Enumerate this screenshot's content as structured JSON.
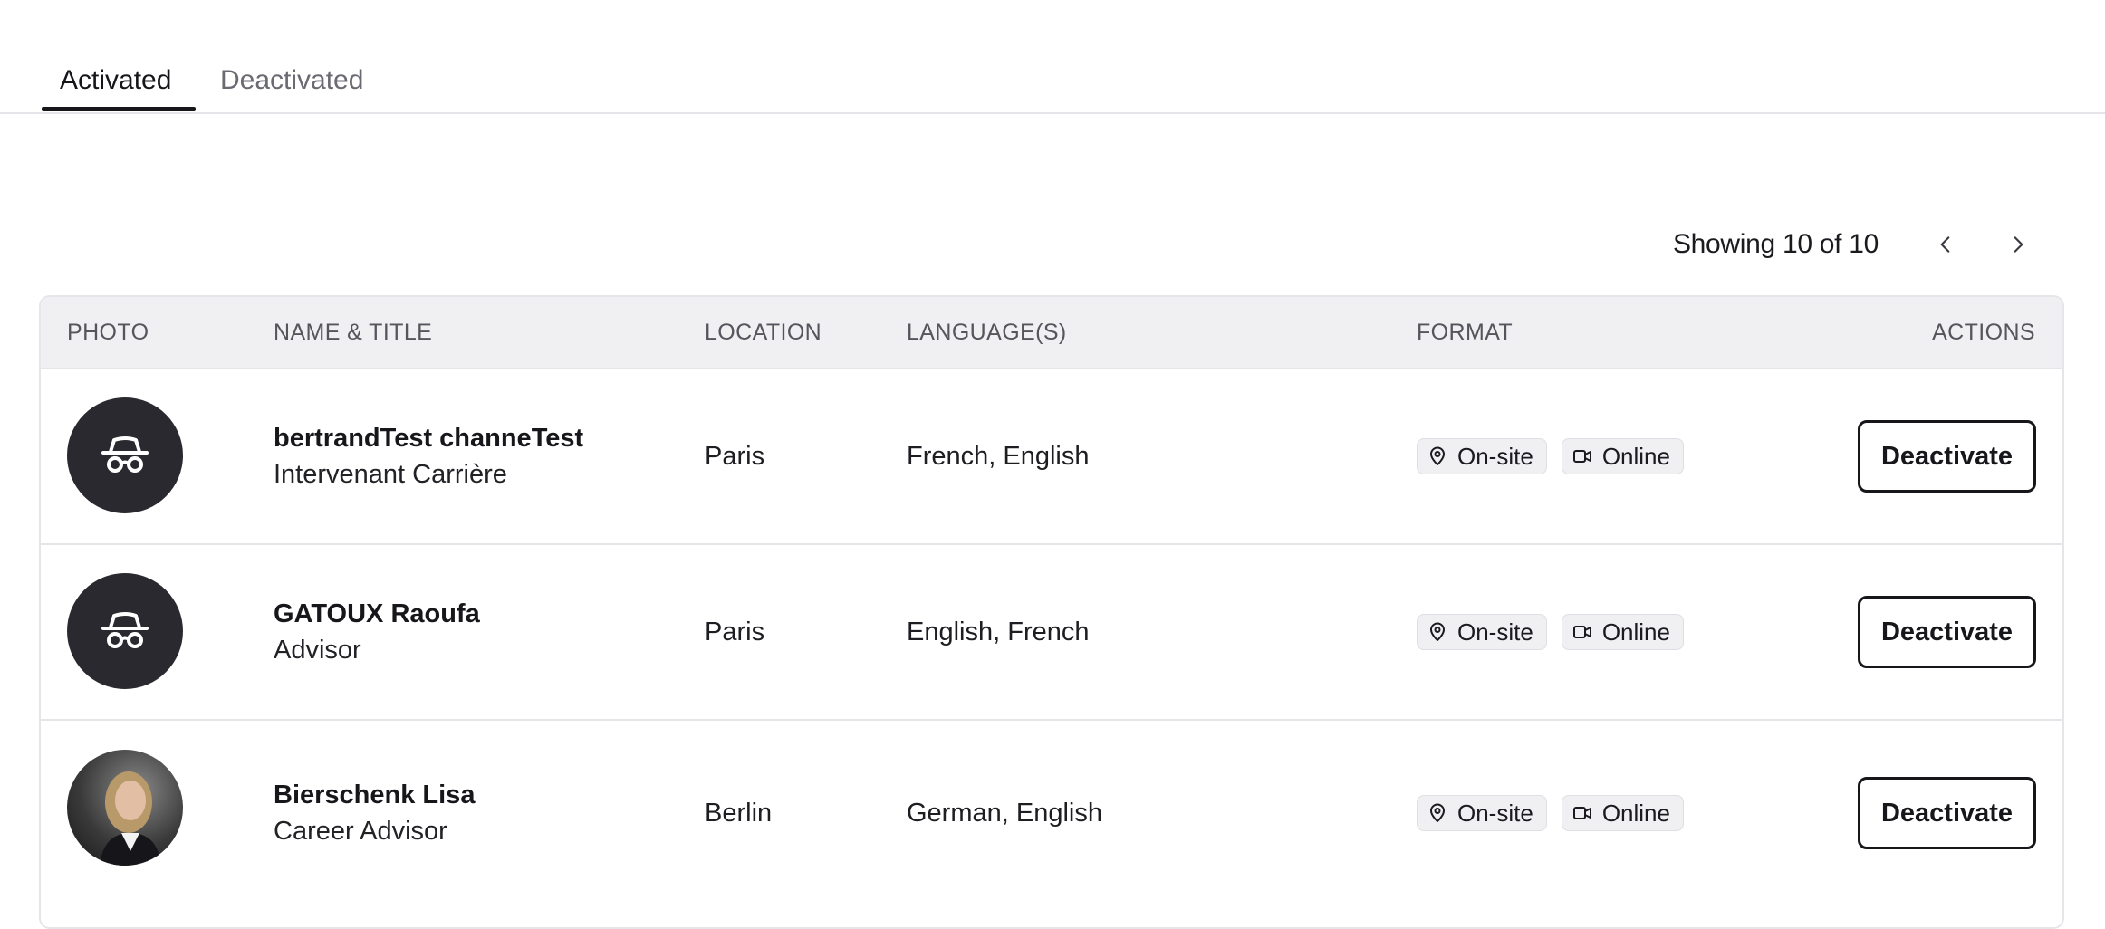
{
  "tabs": [
    {
      "label": "Activated",
      "active": true
    },
    {
      "label": "Deactivated",
      "active": false
    }
  ],
  "pagination": {
    "text": "Showing 10 of 10",
    "prev_icon": "chevron-left-icon",
    "next_icon": "chevron-right-icon"
  },
  "table": {
    "headers": {
      "photo": "PHOTO",
      "name": "NAME & TITLE",
      "location": "LOCATION",
      "language": "LANGUAGE(S)",
      "format": "FORMAT",
      "actions": "ACTIONS"
    },
    "rows": [
      {
        "avatar": "incognito-icon",
        "name": "bertrandTest channeTest",
        "title": "Intervenant Carrière",
        "location": "Paris",
        "languages": "French, English",
        "formats": [
          "On-site",
          "Online"
        ],
        "action": "Deactivate"
      },
      {
        "avatar": "incognito-icon",
        "name": "GATOUX Raoufa",
        "title": "Advisor",
        "location": "Paris",
        "languages": "English, French",
        "formats": [
          "On-site",
          "Online"
        ],
        "action": "Deactivate"
      },
      {
        "avatar": "photo",
        "name": "Bierschenk Lisa",
        "title": "Career Advisor",
        "location": "Berlin",
        "languages": "German, English",
        "formats": [
          "On-site",
          "Online"
        ],
        "action": "Deactivate"
      }
    ]
  },
  "colors": {
    "primary_text": "#17171b",
    "muted_text": "#6a6a72",
    "header_bg": "#f0f0f3",
    "border": "#e6e6ea",
    "avatar_bg": "#2a292f"
  }
}
